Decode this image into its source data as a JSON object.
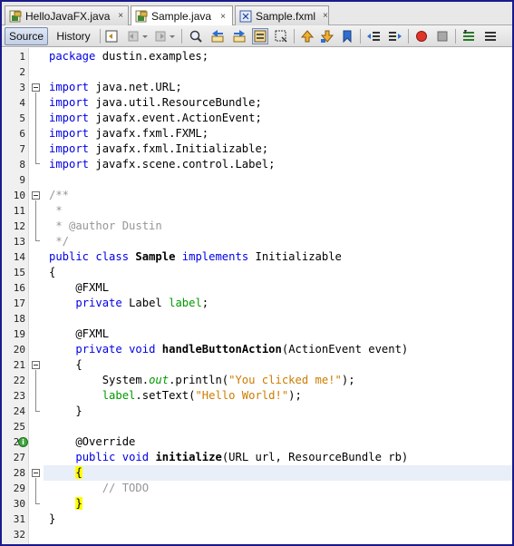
{
  "tabs": [
    {
      "label": "HelloJavaFX.java",
      "icon": "java-file-icon",
      "active": false
    },
    {
      "label": "Sample.java",
      "icon": "java-file-icon",
      "active": true
    },
    {
      "label": "Sample.fxml",
      "icon": "fxml-file-icon",
      "active": false
    }
  ],
  "close_glyph": "×",
  "toolbar": {
    "source_label": "Source",
    "history_label": "History"
  },
  "editor": {
    "current_line": 28,
    "line_numbers": [
      "1",
      "2",
      "3",
      "4",
      "5",
      "6",
      "7",
      "8",
      "9",
      "10",
      "11",
      "12",
      "13",
      "14",
      "15",
      "16",
      "17",
      "18",
      "19",
      "20",
      "21",
      "22",
      "23",
      "24",
      "25",
      "26",
      "27",
      "28",
      "29",
      "30",
      "31",
      "32"
    ],
    "lines": [
      [
        {
          "t": "package",
          "c": "kw"
        },
        {
          "t": " dustin.examples;"
        }
      ],
      [],
      [
        {
          "t": "import",
          "c": "kw"
        },
        {
          "t": " java.net.URL;"
        }
      ],
      [
        {
          "t": "import",
          "c": "kw"
        },
        {
          "t": " java.util.ResourceBundle;"
        }
      ],
      [
        {
          "t": "import",
          "c": "kw"
        },
        {
          "t": " javafx.event.ActionEvent;"
        }
      ],
      [
        {
          "t": "import",
          "c": "kw"
        },
        {
          "t": " javafx.fxml.FXML;"
        }
      ],
      [
        {
          "t": "import",
          "c": "kw"
        },
        {
          "t": " javafx.fxml.Initializable;"
        }
      ],
      [
        {
          "t": "import",
          "c": "kw"
        },
        {
          "t": " javafx.scene.control.Label;"
        }
      ],
      [],
      [
        {
          "t": "/**",
          "c": "cm"
        }
      ],
      [
        {
          "t": " *",
          "c": "cm"
        }
      ],
      [
        {
          "t": " * @author Dustin",
          "c": "cm"
        }
      ],
      [
        {
          "t": " */",
          "c": "cm"
        }
      ],
      [
        {
          "t": "public",
          "c": "kw"
        },
        {
          "t": " "
        },
        {
          "t": "class",
          "c": "kw"
        },
        {
          "t": " "
        },
        {
          "t": "Sample",
          "c": "bold"
        },
        {
          "t": " "
        },
        {
          "t": "implements",
          "c": "kw"
        },
        {
          "t": " Initializable"
        }
      ],
      [
        {
          "t": "{"
        }
      ],
      [
        {
          "t": "    @FXML",
          "c": "anno"
        }
      ],
      [
        {
          "t": "    "
        },
        {
          "t": "private",
          "c": "kw"
        },
        {
          "t": " Label "
        },
        {
          "t": "label",
          "c": "fld"
        },
        {
          "t": ";"
        }
      ],
      [],
      [
        {
          "t": "    @FXML",
          "c": "anno"
        }
      ],
      [
        {
          "t": "    "
        },
        {
          "t": "private",
          "c": "kw"
        },
        {
          "t": " "
        },
        {
          "t": "void",
          "c": "kw"
        },
        {
          "t": " "
        },
        {
          "t": "handleButtonAction",
          "c": "bold"
        },
        {
          "t": "(ActionEvent event)"
        }
      ],
      [
        {
          "t": "    {"
        }
      ],
      [
        {
          "t": "        System."
        },
        {
          "t": "out",
          "c": "fld ital"
        },
        {
          "t": ".println("
        },
        {
          "t": "\"You clicked me!\"",
          "c": "st"
        },
        {
          "t": ");"
        }
      ],
      [
        {
          "t": "        "
        },
        {
          "t": "label",
          "c": "fld"
        },
        {
          "t": ".setText("
        },
        {
          "t": "\"Hello World!\"",
          "c": "st"
        },
        {
          "t": ");"
        }
      ],
      [
        {
          "t": "    }"
        }
      ],
      [],
      [
        {
          "t": "    @Override",
          "c": "anno"
        }
      ],
      [
        {
          "t": "    "
        },
        {
          "t": "public",
          "c": "kw"
        },
        {
          "t": " "
        },
        {
          "t": "void",
          "c": "kw"
        },
        {
          "t": " "
        },
        {
          "t": "initialize",
          "c": "bold"
        },
        {
          "t": "(URL url, ResourceBundle rb)"
        }
      ],
      [
        {
          "t": "    "
        },
        {
          "t": "{",
          "c": "bracehl"
        }
      ],
      [
        {
          "t": "        // TODO",
          "c": "cm"
        }
      ],
      [
        {
          "t": "    "
        },
        {
          "t": "}",
          "c": "bracehl"
        }
      ],
      [
        {
          "t": "}"
        }
      ],
      []
    ]
  }
}
